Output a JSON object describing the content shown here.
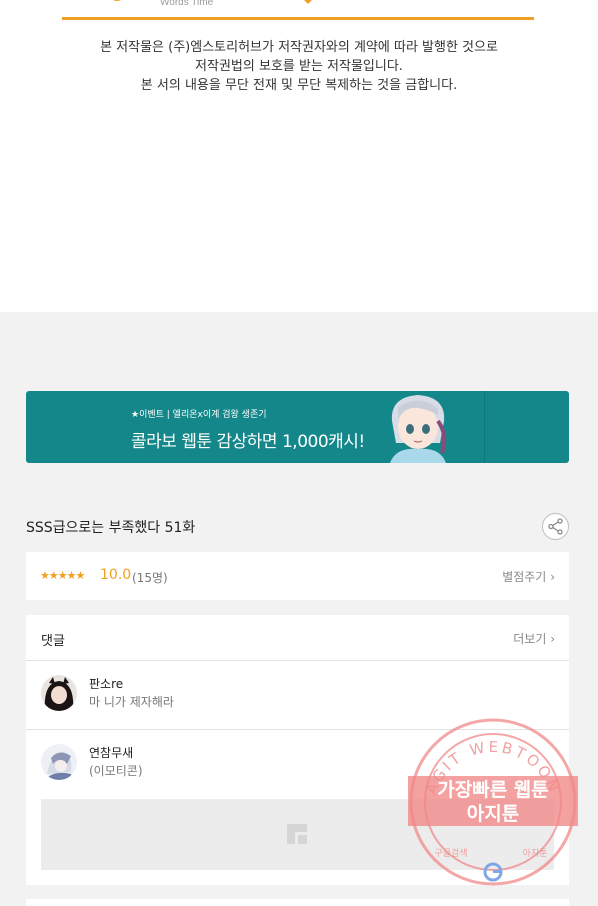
{
  "top": {
    "logo_subtitle": "Words Time",
    "notice_lines": [
      "본 저작물은 (주)엠스토리허브가 저작권자와의 계약에 따라 발행한 것으로",
      "저작권법의 보호를 받는 저작물입니다.",
      "본 서의 내용을 무단 전재 및 무단 복제하는 것을 금합니다."
    ]
  },
  "banner": {
    "sub": "★이벤트 | 엘리온x이계 검왕 생존기",
    "main": "콜라보 웹툰 감상하면 1,000캐시!"
  },
  "episode": {
    "title": "SSS급으로는 부족했다 51화",
    "share_icon": "share-icon"
  },
  "rating": {
    "stars": "★★★★★",
    "score": "10.0",
    "count": "(15명)",
    "rate_label": "별점주기",
    "chevron": "›"
  },
  "comments": {
    "title": "댓글",
    "more_label": "더보기",
    "chevron": "›",
    "items": [
      {
        "name": "판소re",
        "text": "마 니가 제자해라"
      },
      {
        "name": "연참무새",
        "text": "(이모티콘)"
      }
    ]
  },
  "watermark": {
    "ring_text": "AGIT WEBTOON",
    "line1": "가장빠른 웹툰",
    "line2": "아지툰",
    "bottom_left": "구글검색",
    "bottom_right": "아지툰"
  },
  "colors": {
    "accent_orange": "#f0a020",
    "banner_teal": "#14878a",
    "page_grey": "#f2f2f2",
    "watermark_red": "#f08a8a"
  }
}
